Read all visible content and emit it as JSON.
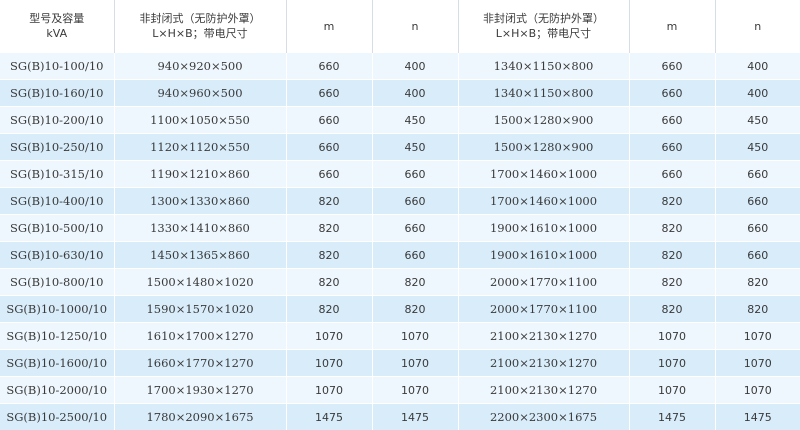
{
  "header": {
    "model_line1": "型号及容量",
    "model_line2": "kVA",
    "dim1_line1": "非封闭式（无防护外罩）",
    "dim1_line2": "L×H×B；带电尺寸",
    "m1": "m",
    "n1": "n",
    "dim2_line1": "非封闭式（无防护外罩）",
    "dim2_line2": "L×H×B；带电尺寸",
    "m2": "m",
    "n2": "n"
  },
  "rows": [
    [
      "SG(B)10-100/10",
      "940×920×500",
      "660",
      "400",
      "1340×1150×800",
      "660",
      "400"
    ],
    [
      "SG(B)10-160/10",
      "940×960×500",
      "660",
      "400",
      "1340×1150×800",
      "660",
      "400"
    ],
    [
      "SG(B)10-200/10",
      "1100×1050×550",
      "660",
      "450",
      "1500×1280×900",
      "660",
      "450"
    ],
    [
      "SG(B)10-250/10",
      "1120×1120×550",
      "660",
      "450",
      "1500×1280×900",
      "660",
      "450"
    ],
    [
      "SG(B)10-315/10",
      "1190×1210×860",
      "660",
      "660",
      "1700×1460×1000",
      "660",
      "660"
    ],
    [
      "SG(B)10-400/10",
      "1300×1330×860",
      "820",
      "660",
      "1700×1460×1000",
      "820",
      "660"
    ],
    [
      "SG(B)10-500/10",
      "1330×1410×860",
      "820",
      "660",
      "1900×1610×1000",
      "820",
      "660"
    ],
    [
      "SG(B)10-630/10",
      "1450×1365×860",
      "820",
      "660",
      "1900×1610×1000",
      "820",
      "660"
    ],
    [
      "SG(B)10-800/10",
      "1500×1480×1020",
      "820",
      "820",
      "2000×1770×1100",
      "820",
      "820"
    ],
    [
      "SG(B)10-1000/10",
      "1590×1570×1020",
      "820",
      "820",
      "2000×1770×1100",
      "820",
      "820"
    ],
    [
      "SG(B)10-1250/10",
      "1610×1700×1270",
      "1070",
      "1070",
      "2100×2130×1270",
      "1070",
      "1070"
    ],
    [
      "SG(B)10-1600/10",
      "1660×1770×1270",
      "1070",
      "1070",
      "2100×2130×1270",
      "1070",
      "1070"
    ],
    [
      "SG(B)10-2000/10",
      "1700×1930×1270",
      "1070",
      "1070",
      "2100×2130×1270",
      "1070",
      "1070"
    ],
    [
      "SG(B)10-2500/10",
      "1780×2090×1675",
      "1475",
      "1475",
      "2200×2300×1675",
      "1475",
      "1475"
    ]
  ]
}
